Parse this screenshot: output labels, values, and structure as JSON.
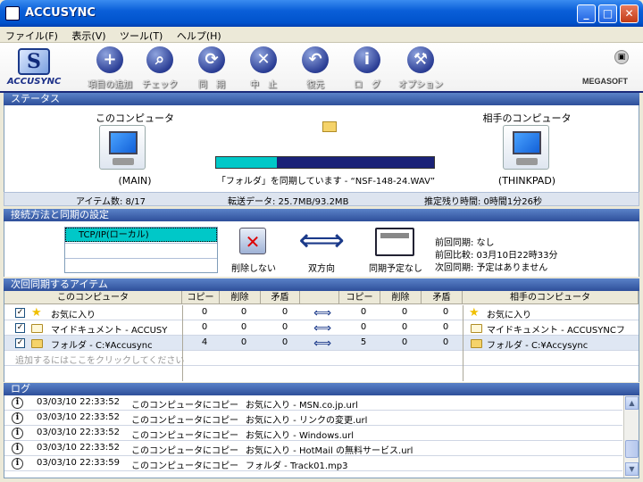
{
  "window": {
    "title": "ACCUSYNC"
  },
  "menu": [
    "ファイル(F)",
    "表示(V)",
    "ツール(T)",
    "ヘルプ(H)"
  ],
  "toolbar": {
    "logo_text": "ACCUSYNC",
    "brand": "MEGASOFT",
    "buttons": [
      {
        "label": "項目の追加",
        "icon": "plus-icon"
      },
      {
        "label": "チェック",
        "icon": "magnifier-icon"
      },
      {
        "label": "同　期",
        "icon": "sync-icon"
      },
      {
        "label": "中　止",
        "icon": "stop-icon"
      },
      {
        "label": "復元",
        "icon": "restore-icon"
      },
      {
        "label": "ロ　グ",
        "icon": "info-icon"
      },
      {
        "label": "オプション",
        "icon": "wrench-icon"
      }
    ]
  },
  "status": {
    "header": "ステータス",
    "left_label": "このコンピュータ",
    "left_name": "(MAIN)",
    "right_label": "相手のコンピュータ",
    "right_name": "(THINKPAD)",
    "progress": 0.28,
    "message": "「フォルダ」を同期しています - “NSF-148-24.WAV”",
    "items": "アイテム数: 8/17",
    "transfer": "転送データ: 25.7MB/93.2MB",
    "remaining": "推定残り時間: 0時間1分26秒"
  },
  "settings": {
    "header": "接続方法と同期の設定",
    "protocol": "TCP/IP(ローカル)",
    "delete_label": "削除しない",
    "direction_label": "双方向",
    "schedule_label": "同期予定なし",
    "last_sync": "前回同期: なし",
    "last_compare": "前回比較: 03月10日22時33分",
    "next_sync": "次回同期: 予定はありません"
  },
  "items": {
    "header": "次回同期するアイテム",
    "columns": {
      "local": "このコンピュータ",
      "copy": "コピー",
      "delete": "削除",
      "conflict": "矛盾",
      "remote": "相手のコンピュータ"
    },
    "rows": [
      {
        "icon": "star-icon",
        "local": "お気に入り",
        "c1": "0",
        "d1": "0",
        "x1": "0",
        "c2": "0",
        "d2": "0",
        "x2": "0",
        "remote": "お気に入り"
      },
      {
        "icon": "document-icon",
        "local": "マイドキュメント - ACCUSY",
        "c1": "0",
        "d1": "0",
        "x1": "0",
        "c2": "0",
        "d2": "0",
        "x2": "0",
        "remote": "マイドキュメント - ACCUSYNCフ"
      },
      {
        "icon": "folder-icon",
        "local": "フォルダ - C:¥Accusync",
        "c1": "4",
        "d1": "0",
        "x1": "0",
        "c2": "5",
        "d2": "0",
        "x2": "0",
        "remote": "フォルダ - C:¥Accysync"
      }
    ],
    "add_hint": "追加するにはここをクリックしてください"
  },
  "log": {
    "header": "ログ",
    "rows": [
      {
        "time": "03/03/10 22:33:52",
        "action": "このコンピュータにコピー",
        "target": "お気に入り - MSN.co.jp.url"
      },
      {
        "time": "03/03/10 22:33:52",
        "action": "このコンピュータにコピー",
        "target": "お気に入り - リンクの変更.url"
      },
      {
        "time": "03/03/10 22:33:52",
        "action": "このコンピュータにコピー",
        "target": "お気に入り - Windows.url"
      },
      {
        "time": "03/03/10 22:33:52",
        "action": "このコンピュータにコピー",
        "target": "お気に入り - HotMail の無料サービス.url"
      },
      {
        "time": "03/03/10 22:33:59",
        "action": "このコンピュータにコピー",
        "target": "フォルダ - Track01.mp3"
      }
    ]
  }
}
